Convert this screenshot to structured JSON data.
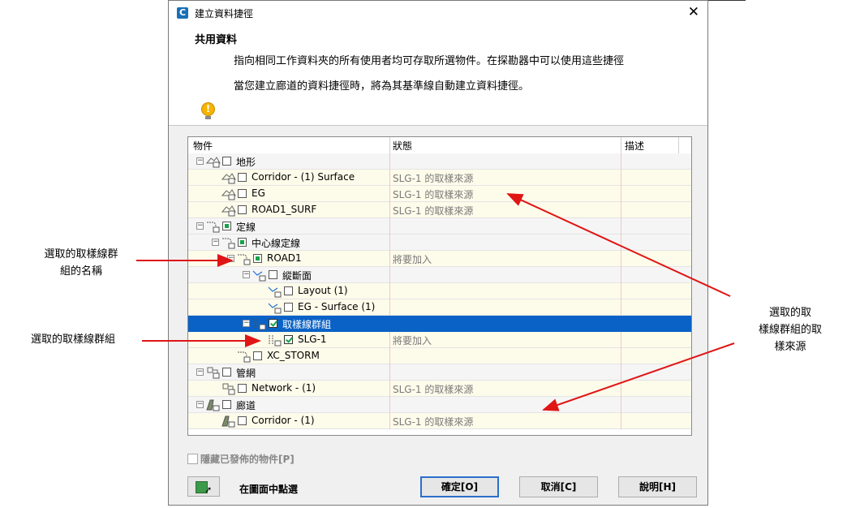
{
  "window": {
    "app_icon": "C",
    "title": "建立資料捷徑",
    "close": "✕"
  },
  "header": {
    "title": "共用資料",
    "line1": "指向相同工作資料夾的所有使用者均可存取所選物件。在探勘器中可以使用這些捷徑",
    "line2": "當您建立廊道的資料捷徑時，將為其基準線自動建立資料捷徑。",
    "warning_icon": "lightbulb-warning-icon"
  },
  "tree": {
    "columns": [
      "物件",
      "狀態",
      "描述"
    ],
    "rows": [
      {
        "name": "地形",
        "status": "",
        "depth": 0,
        "expander": "⊟",
        "icon": "surface-icon",
        "check": "none",
        "style": "grp"
      },
      {
        "name": "Corridor - (1) Surface",
        "status": "SLG-1 的取樣來源",
        "depth": 1,
        "expander": "",
        "icon": "surface-icon",
        "check": "none",
        "style": "pale"
      },
      {
        "name": "EG",
        "status": "SLG-1 的取樣來源",
        "depth": 1,
        "expander": "",
        "icon": "surface-icon",
        "check": "none",
        "style": "pale"
      },
      {
        "name": "ROAD1_SURF",
        "status": "SLG-1 的取樣來源",
        "depth": 1,
        "expander": "",
        "icon": "surface-icon",
        "check": "none",
        "style": "pale"
      },
      {
        "name": "定線",
        "status": "",
        "depth": 0,
        "expander": "⊟",
        "icon": "alignment-icon",
        "check": "partial",
        "style": "grp"
      },
      {
        "name": "中心線定線",
        "status": "",
        "depth": 1,
        "expander": "⊟",
        "icon": "alignment-icon",
        "check": "partial",
        "style": "grp"
      },
      {
        "name": "ROAD1",
        "status": "將要加入",
        "depth": 2,
        "expander": "⊟",
        "icon": "alignment-icon",
        "check": "partial",
        "style": "pale"
      },
      {
        "name": "縱斷面",
        "status": "",
        "depth": 3,
        "expander": "⊟",
        "icon": "profile-icon",
        "check": "none",
        "style": "grp"
      },
      {
        "name": "Layout (1)",
        "status": "",
        "depth": 4,
        "expander": "",
        "icon": "profile-icon",
        "check": "none",
        "style": "pale"
      },
      {
        "name": "EG - Surface (1)",
        "status": "",
        "depth": 4,
        "expander": "",
        "icon": "profile-icon",
        "check": "none",
        "style": "pale"
      },
      {
        "name": "取樣線群組",
        "status": "",
        "depth": 3,
        "expander": "⊟",
        "icon": "sample-line-group-icon",
        "check": "checked",
        "style": "sel"
      },
      {
        "name": "SLG-1",
        "status": "將要加入",
        "depth": 4,
        "expander": "",
        "icon": "sample-line-group-icon",
        "check": "checked",
        "style": "pale"
      },
      {
        "name": "XC_STORM",
        "status": "",
        "depth": 2,
        "expander": "",
        "icon": "alignment-icon",
        "check": "none",
        "style": "pale"
      },
      {
        "name": "管網",
        "status": "",
        "depth": 0,
        "expander": "⊟",
        "icon": "pipe-network-icon",
        "check": "none",
        "style": "grp"
      },
      {
        "name": "Network - (1)",
        "status": "SLG-1 的取樣來源",
        "depth": 1,
        "expander": "",
        "icon": "pipe-network-icon",
        "check": "none",
        "style": "pale"
      },
      {
        "name": "廊道",
        "status": "",
        "depth": 0,
        "expander": "⊟",
        "icon": "corridor-icon",
        "check": "none",
        "style": "grp"
      },
      {
        "name": "Corridor - (1)",
        "status": "SLG-1 的取樣來源",
        "depth": 1,
        "expander": "",
        "icon": "corridor-icon",
        "check": "none",
        "style": "pale"
      }
    ]
  },
  "footer": {
    "hide_published_label": "隱藏已發佈的物件[P]",
    "pick_icon": "pick-in-drawing-icon",
    "pick_label": "在圖面中點選",
    "ok": "確定[O]",
    "cancel": "取消[C]",
    "help": "說明[H]"
  },
  "callouts": {
    "group_name": "選取的取樣線群\n組的名稱",
    "group": "選取的取樣線群組",
    "sources": "選取的取\n樣線群組的取\n樣來源"
  },
  "colors": {
    "selection": "#0a62c6",
    "arrow": "#e01515",
    "warning": "#f5b400",
    "check": "#16a34a"
  }
}
